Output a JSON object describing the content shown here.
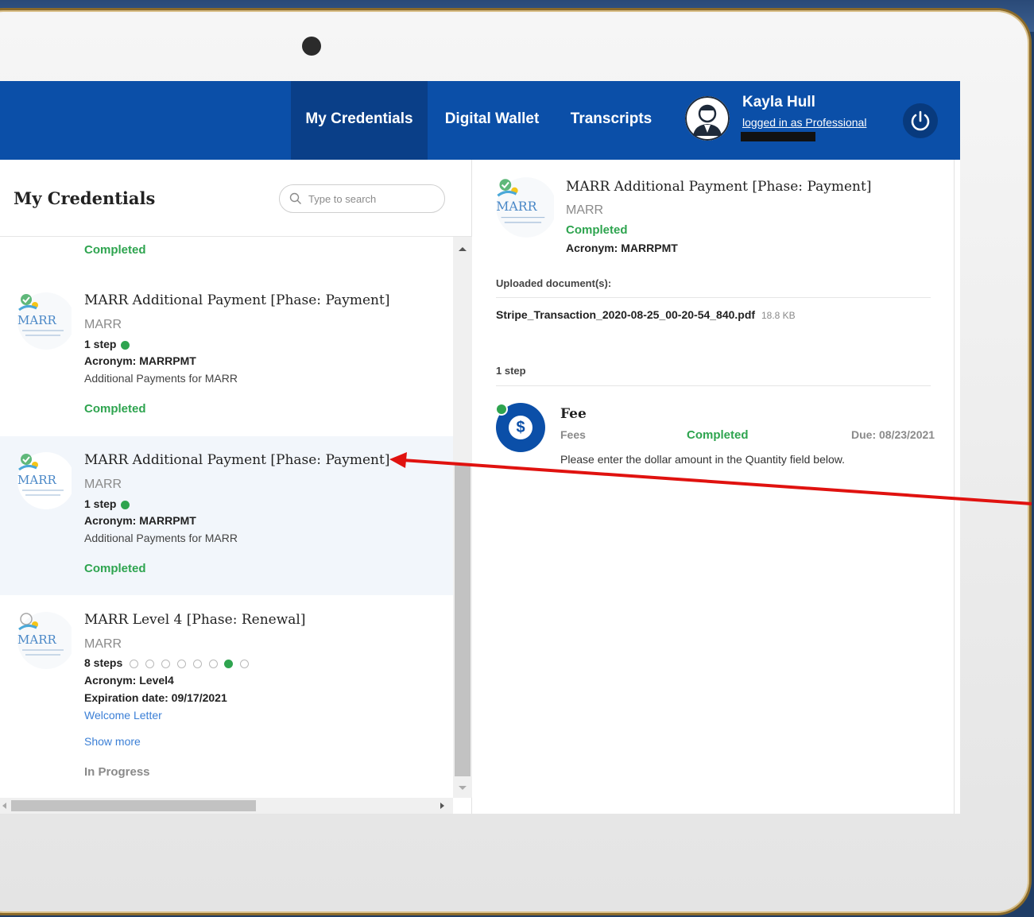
{
  "nav": {
    "items": [
      {
        "label": "My Credentials",
        "active": true
      },
      {
        "label": "Digital Wallet",
        "active": false
      },
      {
        "label": "Transcripts",
        "active": false
      }
    ],
    "user_name": "Kayla Hull",
    "user_role": "logged in as Professional"
  },
  "left": {
    "title": "My Credentials",
    "search_placeholder": "Type to search",
    "top_status": "Completed",
    "cards": [
      {
        "title": "MARR Additional Payment [Phase: Payment]",
        "org": "MARR",
        "steps": "1 step",
        "acronym": "Acronym: MARRPMT",
        "description": "Additional Payments for MARR",
        "status": "Completed"
      },
      {
        "title": "MARR Additional Payment [Phase: Payment]",
        "org": "MARR",
        "steps": "1 step",
        "acronym": "Acronym: MARRPMT",
        "description": "Additional Payments for MARR",
        "status": "Completed"
      },
      {
        "title": "MARR Level 4 [Phase: Renewal]",
        "org": "MARR",
        "steps": "8 steps",
        "acronym": "Acronym: Level4",
        "expiration": "Expiration date: 09/17/2021",
        "link": "Welcome Letter",
        "show_more": "Show more",
        "status": "In Progress"
      }
    ]
  },
  "detail": {
    "title": "MARR Additional Payment [Phase: Payment]",
    "org": "MARR",
    "status": "Completed",
    "acronym": "Acronym: MARRPMT",
    "uploaded_label": "Uploaded document(s):",
    "file_name": "Stripe_Transaction_2020-08-25_00-20-54_840.pdf",
    "file_size": "18.8 KB",
    "steps_label": "1 step",
    "step": {
      "name": "Fee",
      "type": "Fees",
      "status": "Completed",
      "due": "Due: 08/23/2021",
      "instruction": "Please enter the dollar amount in the Quantity field below."
    }
  },
  "logo_text": "MARR",
  "colors": {
    "nav_bg": "#0b4fa8",
    "completed": "#2ea44f",
    "link": "#3b7fd6",
    "annotation_arrow": "#e0120f"
  }
}
